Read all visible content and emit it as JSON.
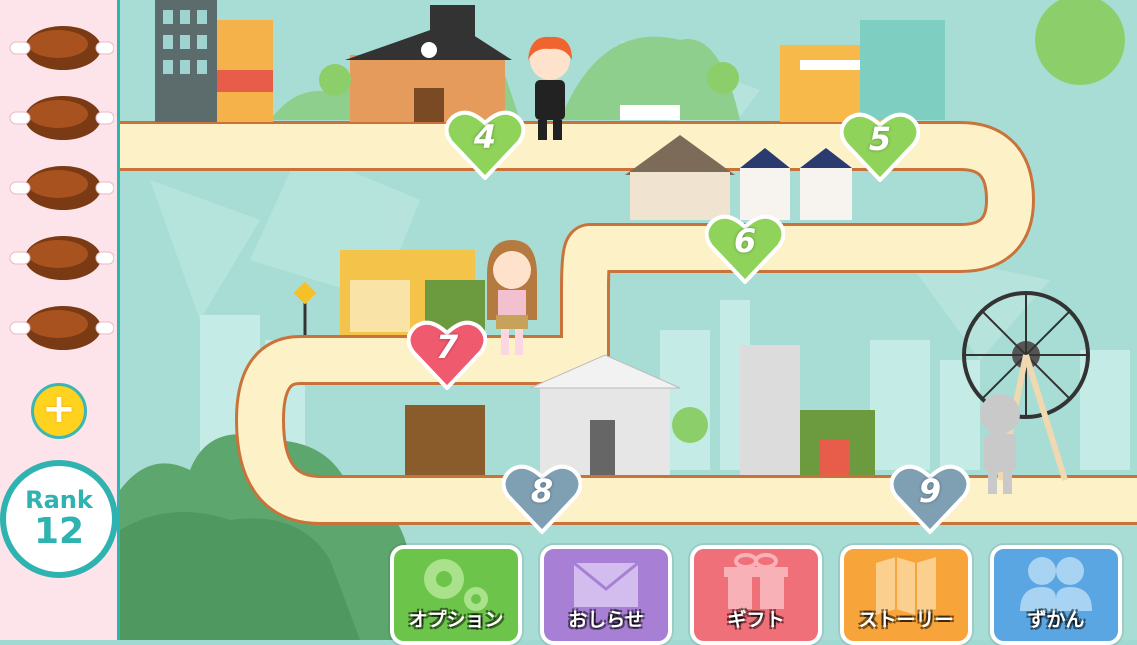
{
  "stamina": {
    "count": 5,
    "item_icon": "meat-icon",
    "add_label": "+"
  },
  "rank": {
    "label": "Rank",
    "value": "12"
  },
  "stages": [
    {
      "number": "4",
      "state": "cleared",
      "color": "#8fd35a"
    },
    {
      "number": "5",
      "state": "cleared",
      "color": "#8fd35a"
    },
    {
      "number": "6",
      "state": "cleared",
      "color": "#8fd35a"
    },
    {
      "number": "7",
      "state": "current",
      "color": "#f05a6e"
    },
    {
      "number": "8",
      "state": "locked",
      "color": "#7f9fb3"
    },
    {
      "number": "9",
      "state": "locked",
      "color": "#7f9fb3"
    }
  ],
  "menu": {
    "option": "オプション",
    "news": "おしらせ",
    "gift": "ギフト",
    "story": "ストーリー",
    "book": "ずかん"
  },
  "colors": {
    "road": "#fdf1c8",
    "road_border": "#c9733b",
    "sidebar_bg": "#fde3ea",
    "accent": "#2fb3b0"
  }
}
